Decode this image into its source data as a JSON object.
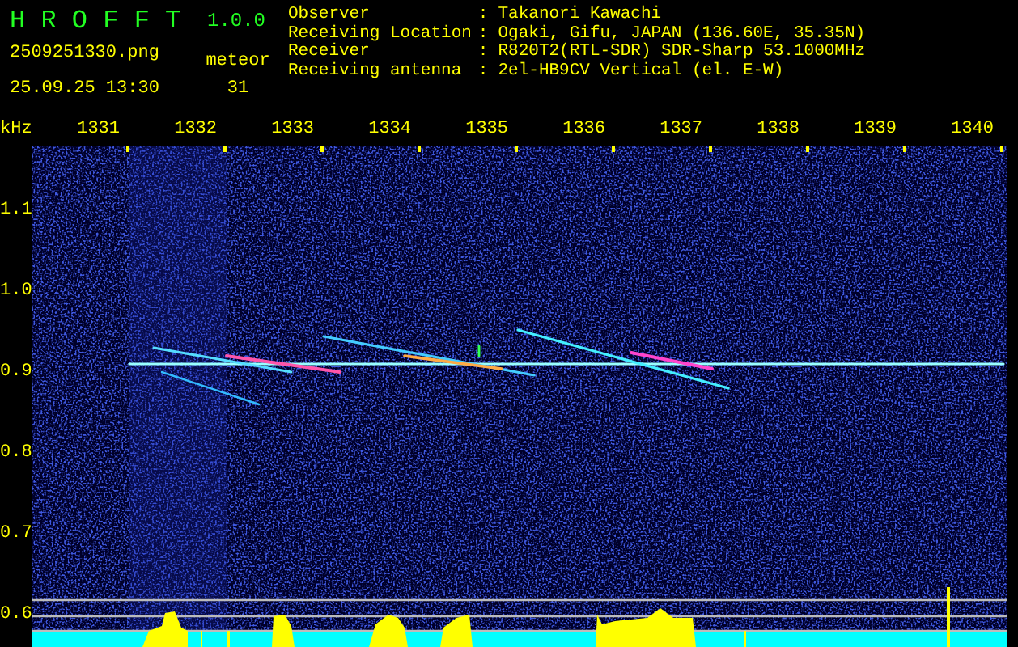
{
  "app": {
    "title": "H R O F F T",
    "version": "1.0.0",
    "file": "2509251330.png",
    "datetime": "25.09.25 13:30",
    "count_label": "meteor",
    "count": "31"
  },
  "station": [
    {
      "label": "Observer",
      "separator": ":",
      "value": "Takanori Kawachi"
    },
    {
      "label": "Receiving Location",
      "separator": ":",
      "value": "Ogaki, Gifu, JAPAN (136.60E, 35.35N)"
    },
    {
      "label": "Receiver",
      "separator": ":",
      "value": "R820T2(RTL-SDR) SDR-Sharp 53.1000MHz"
    },
    {
      "label": "Receiving antenna",
      "separator": ":",
      "value": "2el-HB9CV Vertical (el. E-W)"
    }
  ],
  "plot": {
    "y_unit": "kHz",
    "x_labels": [
      "1331",
      "1332",
      "1333",
      "1334",
      "1335",
      "1336",
      "1337",
      "1338",
      "1339",
      "1340"
    ],
    "y_labels": [
      "1.1",
      "1.0",
      "0.9",
      "0.8",
      "0.7",
      "0.6"
    ]
  }
}
